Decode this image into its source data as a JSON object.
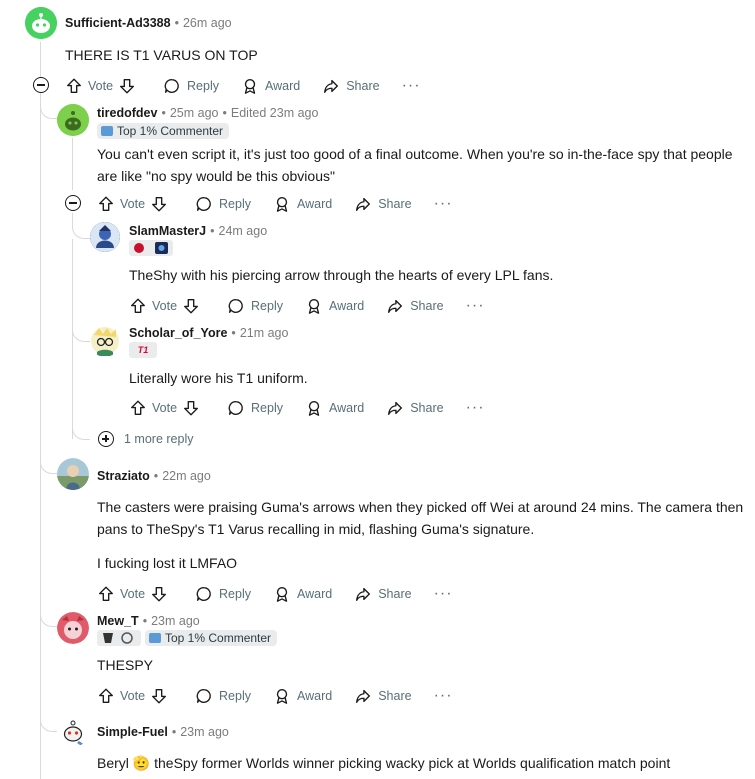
{
  "actions": {
    "vote": "Vote",
    "reply": "Reply",
    "award": "Award",
    "share": "Share",
    "more": "···"
  },
  "comments": {
    "c1": {
      "user": "Sufficient-Ad3388",
      "time": "26m ago",
      "body": "THERE IS T1 VARUS ON TOP"
    },
    "c2": {
      "user": "tiredofdev",
      "time": "25m ago",
      "edited": "Edited 23m ago",
      "flair": "Top 1% Commenter",
      "body": "You can't even script it, it's just too good of a final outcome. When you're so in-the-face spy that people are like \"no spy would be this obvious\""
    },
    "c3": {
      "user": "SlamMasterJ",
      "time": "24m ago",
      "body": "TheShy with his piercing arrow through the hearts of every LPL fans."
    },
    "c4": {
      "user": "Scholar_of_Yore",
      "time": "21m ago",
      "badge": "T1",
      "body": "Literally wore his T1 uniform."
    },
    "more_replies": "1 more reply",
    "c5": {
      "user": "Straziato",
      "time": "22m ago",
      "body1": "The casters were praising Guma's arrows when they picked off Wei at around 24 mins. The camera then pans to TheSpy's T1 Varus recalling in mid, flashing Guma's signature.",
      "body2": "I fucking lost it LMFAO"
    },
    "c6": {
      "user": "Mew_T",
      "time": "23m ago",
      "flair": "Top 1% Commenter",
      "body": "THESPY"
    },
    "c7": {
      "user": "Simple-Fuel",
      "time": "23m ago",
      "body": "Beryl 🫡 theSpy former Worlds winner picking wacky pick at Worlds qualification match point"
    }
  },
  "colors": {
    "meta": "#7c7c7c",
    "action": "#576f76",
    "thread": "#d7dadc",
    "flair_bg": "#e9ebed"
  }
}
